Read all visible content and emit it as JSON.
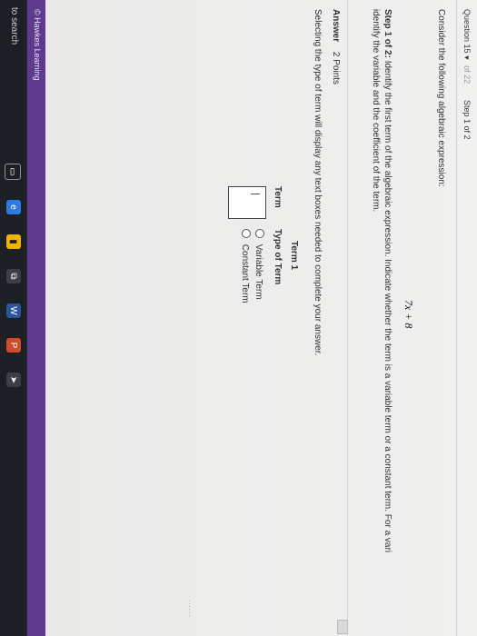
{
  "header": {
    "question_label": "Question 15",
    "question_of": "of 22",
    "step_label": "Step 1 of 2"
  },
  "question": {
    "prompt": "Consider the following algebraic expression:",
    "expression": "7x + 8",
    "step_title_bold": "Step 1 of 2:",
    "step_title_text": "Identify the first term of the algebraic expression. Indicate whether the term is a variable term or a constant term. For a variable term, identify the variable and the coefficient of the term.",
    "step_title_text_visible": "Identify the first term of the algebraic expression. Indicate whether the term is a variable term or a constant term. For a vari",
    "step_title_text_line2": "identify the variable and the coefficient of the term."
  },
  "answer": {
    "label": "Answer",
    "points": "2 Points",
    "selection_note": "Selecting the type of term will display any text boxes needed to complete your answer.",
    "term_header": "Term 1",
    "col_term": "Term",
    "col_type": "Type of Term",
    "options": [
      "Variable Term",
      "Constant Term"
    ]
  },
  "footer": {
    "brand": "© Hawkes Learning"
  },
  "taskbar": {
    "search": "to search",
    "icons": [
      "monitor-icon",
      "edge-icon",
      "folder-icon",
      "task-view-icon",
      "word-icon",
      "powerpoint-icon",
      "arrow-icon"
    ],
    "accent": "#2d7be0"
  },
  "colors": {
    "footer_band": "#5f3b90",
    "page_bg": "#f0f0ef"
  }
}
